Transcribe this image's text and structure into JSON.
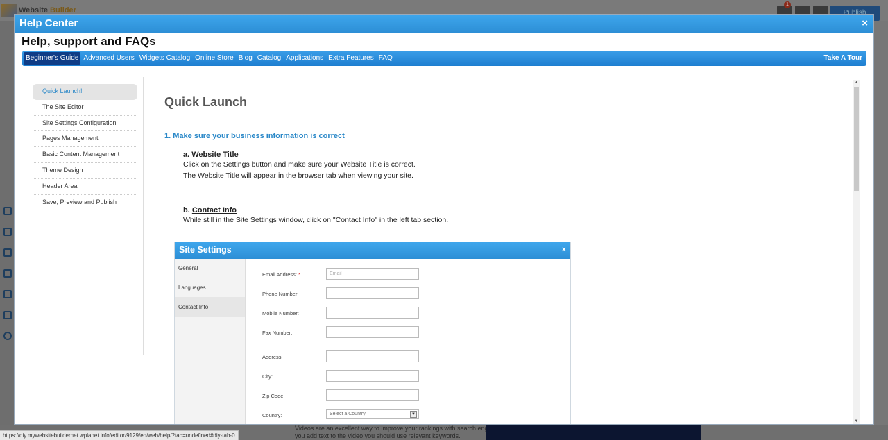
{
  "modal": {
    "title": "Help Center",
    "close": "×",
    "heading": "Help, support and FAQs"
  },
  "tabs": [
    {
      "label": "Beginner's Guide",
      "active": true
    },
    {
      "label": "Advanced Users"
    },
    {
      "label": "Widgets Catalog"
    },
    {
      "label": "Online Store"
    },
    {
      "label": "Blog"
    },
    {
      "label": "Catalog"
    },
    {
      "label": "Applications"
    },
    {
      "label": "Extra Features"
    },
    {
      "label": "FAQ"
    }
  ],
  "tour": "Take A Tour",
  "sidebar": {
    "items": [
      {
        "label": "Quick Launch!"
      },
      {
        "label": "The Site Editor"
      },
      {
        "label": "Site Settings Configuration"
      },
      {
        "label": "Pages Management"
      },
      {
        "label": "Basic Content Management"
      },
      {
        "label": "Theme Design"
      },
      {
        "label": "Header Area"
      },
      {
        "label": "Save, Preview and Publish"
      }
    ]
  },
  "content": {
    "title": "Quick Launch",
    "step1_num": "1.",
    "step1_link": "Make sure your business information is correct",
    "a_prefix": "a.",
    "a_title": "Website Title",
    "a_line1": "Click on the Settings button and make sure your Website Title is correct.",
    "a_line2": "The Website Title will appear in the browser tab when viewing your site.",
    "b_prefix": "b.",
    "b_title": "Contact Info",
    "b_line1": "While still in the Site Settings window, click on \"Contact Info\" in the left tab section."
  },
  "site_settings": {
    "title": "Site Settings",
    "close": "×",
    "nav": [
      "General",
      "Languages",
      "Contact Info"
    ],
    "fields": {
      "email_label": "Email Address:",
      "email_req": "*",
      "email_placeholder": "Email",
      "phone_label": "Phone Number:",
      "mobile_label": "Mobile Number:",
      "fax_label": "Fax Number:",
      "address_label": "Address:",
      "city_label": "City:",
      "zip_label": "Zip Code:",
      "country_label": "Country:",
      "country_select": "Select a Country"
    }
  },
  "background": {
    "logo_a": "Website",
    "logo_b": "Builder",
    "badge": "1",
    "publish": "Publish",
    "bottom_line1": "Videos are an excellent way to improve your rankings with search engines.",
    "bottom_line2": "you add text to the video you should use relevant keywords."
  },
  "status_url": "https://diy.mywebsitebuildernet.wplanet.info/editor/9129/en/web/help/?tab=undefined#diy-tab-0"
}
